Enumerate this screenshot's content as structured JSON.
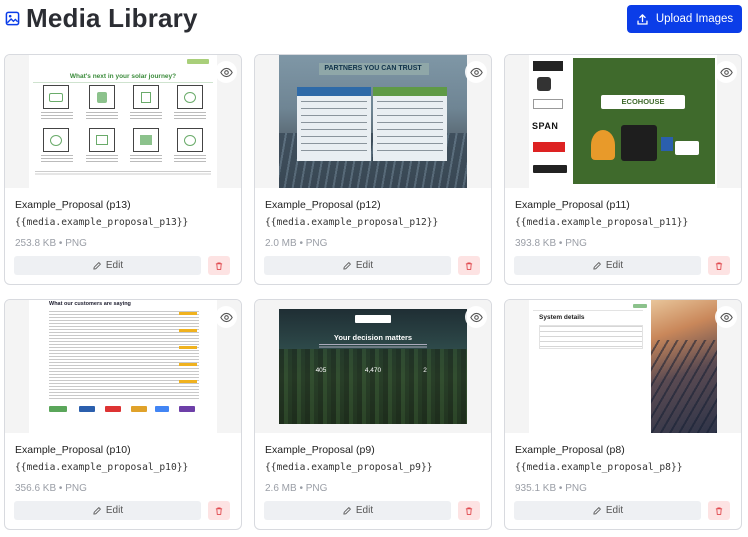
{
  "header": {
    "title": "Media Library",
    "upload_label": "Upload Images"
  },
  "colors": {
    "primary": "#0b3de8",
    "delete_bg": "#fde3e3",
    "delete_icon": "#e0474c"
  },
  "cards": [
    {
      "name": "Example_Proposal (p13)",
      "variable": "{{media.example_proposal_p13}}",
      "meta": "253.8 KB • PNG",
      "edit_label": "Edit",
      "slide": {
        "heading": "What's next in your solar journey?"
      }
    },
    {
      "name": "Example_Proposal (p12)",
      "variable": "{{media.example_proposal_p12}}",
      "meta": "2.0 MB • PNG",
      "edit_label": "Edit",
      "slide": {
        "heading": "PARTNERS YOU CAN TRUST"
      }
    },
    {
      "name": "Example_Proposal (p11)",
      "variable": "{{media.example_proposal_p11}}",
      "meta": "393.8 KB • PNG",
      "edit_label": "Edit",
      "slide": {
        "logo": "ECOHOUSE",
        "side_logo": "SPAN"
      }
    },
    {
      "name": "Example_Proposal (p10)",
      "variable": "{{media.example_proposal_p10}}",
      "meta": "356.6 KB • PNG",
      "edit_label": "Edit",
      "slide": {
        "heading": "What our customers are saying"
      }
    },
    {
      "name": "Example_Proposal (p9)",
      "variable": "{{media.example_proposal_p9}}",
      "meta": "2.6 MB • PNG",
      "edit_label": "Edit",
      "slide": {
        "heading": "Your decision matters",
        "stats": [
          "405",
          "4,470",
          "2"
        ]
      }
    },
    {
      "name": "Example_Proposal (p8)",
      "variable": "{{media.example_proposal_p8}}",
      "meta": "935.1 KB • PNG",
      "edit_label": "Edit",
      "slide": {
        "heading": "System details"
      }
    }
  ]
}
